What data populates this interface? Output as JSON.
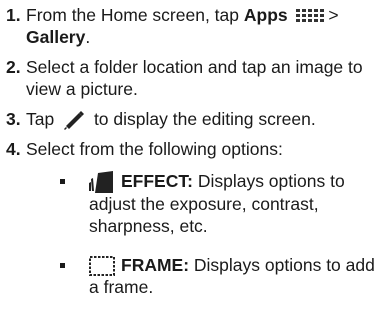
{
  "steps": [
    {
      "num": "1.",
      "pre": "From the Home screen, tap ",
      "bold1": "Apps",
      "mid": " > ",
      "bold2": "Gallery",
      "post": "."
    },
    {
      "num": "2.",
      "text": "Select a folder location and tap an image to view a picture."
    },
    {
      "num": "3.",
      "pre": "Tap ",
      "post": " to display the editing screen."
    },
    {
      "num": "4.",
      "text": "Select from the following options:"
    }
  ],
  "options": [
    {
      "label": "EFFECT:",
      "desc": " Displays options to adjust the exposure, contrast, sharpness, etc.",
      "icon": "effect-icon"
    },
    {
      "label": "FRAME:",
      "desc": " Displays options to add a frame.",
      "icon": "frame-icon"
    }
  ]
}
